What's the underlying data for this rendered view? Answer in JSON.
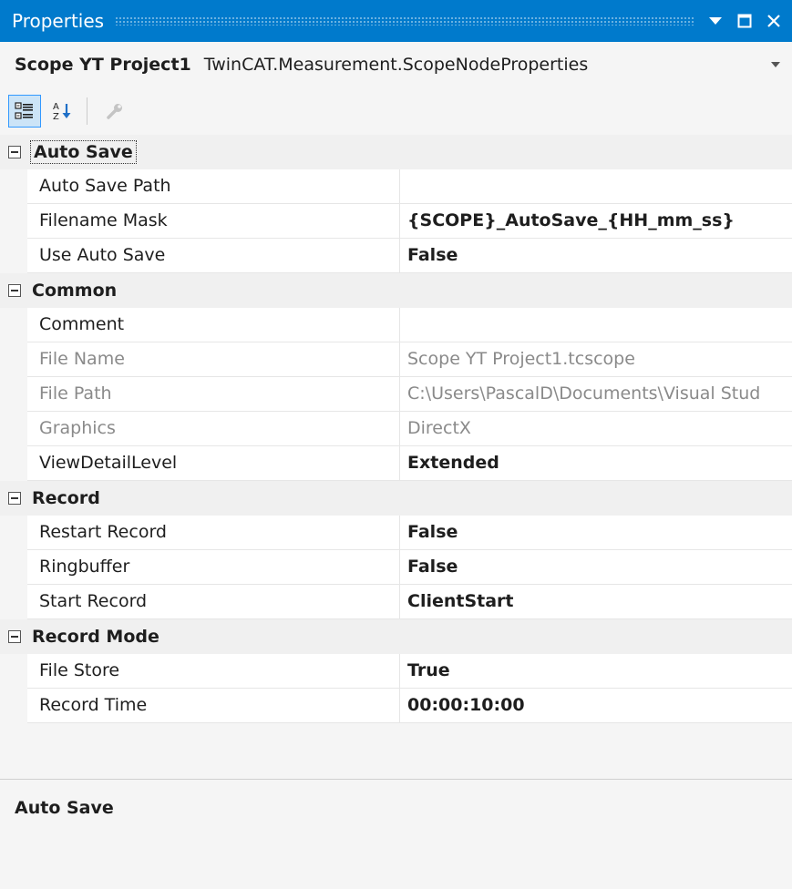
{
  "window": {
    "title": "Properties"
  },
  "selector": {
    "object_name": "Scope YT Project1",
    "object_type": "TwinCAT.Measurement.ScopeNodeProperties"
  },
  "toolbar": {
    "buttons": [
      {
        "name": "categorized-icon",
        "active": true
      },
      {
        "name": "alphabetical-icon",
        "active": false
      },
      {
        "name": "property-pages-icon",
        "active": false,
        "disabled": true
      }
    ]
  },
  "categories": [
    {
      "label": "Auto Save",
      "focused": true,
      "properties": [
        {
          "name": "Auto Save Path",
          "value": "",
          "bold": false,
          "readonly": false
        },
        {
          "name": "Filename Mask",
          "value": "{SCOPE}_AutoSave_{HH_mm_ss}",
          "bold": true,
          "readonly": false
        },
        {
          "name": "Use Auto Save",
          "value": "False",
          "bold": true,
          "readonly": false
        }
      ]
    },
    {
      "label": "Common",
      "focused": false,
      "properties": [
        {
          "name": "Comment",
          "value": "",
          "bold": false,
          "readonly": false
        },
        {
          "name": "File Name",
          "value": "Scope YT Project1.tcscope",
          "bold": false,
          "readonly": true
        },
        {
          "name": "File Path",
          "value": "C:\\Users\\PascalD\\Documents\\Visual Stud",
          "bold": false,
          "readonly": true
        },
        {
          "name": "Graphics",
          "value": "DirectX",
          "bold": false,
          "readonly": true
        },
        {
          "name": "ViewDetailLevel",
          "value": "Extended",
          "bold": true,
          "readonly": false
        }
      ]
    },
    {
      "label": "Record",
      "focused": false,
      "properties": [
        {
          "name": "Restart Record",
          "value": "False",
          "bold": true,
          "readonly": false
        },
        {
          "name": "Ringbuffer",
          "value": "False",
          "bold": true,
          "readonly": false
        },
        {
          "name": "Start Record",
          "value": "ClientStart",
          "bold": true,
          "readonly": false
        }
      ]
    },
    {
      "label": "Record Mode",
      "focused": false,
      "properties": [
        {
          "name": "File Store",
          "value": "True",
          "bold": true,
          "readonly": false
        },
        {
          "name": "Record Time",
          "value": "00:00:10:00",
          "bold": true,
          "readonly": false
        }
      ]
    }
  ],
  "description": {
    "title": "Auto Save"
  },
  "colors": {
    "titlebar": "#007acc",
    "background": "#f5f5f5",
    "readonly_text": "#8a8a8a"
  }
}
